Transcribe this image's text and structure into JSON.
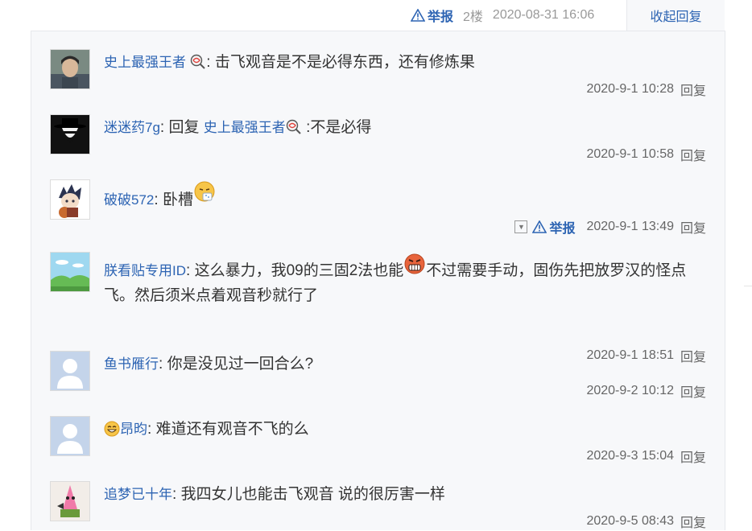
{
  "floor_tail": {
    "report": "举报",
    "floor": "2楼",
    "time": "2020-08-31 16:06",
    "collapse": "收起回复"
  },
  "comments": [
    {
      "user": "史上最强王者",
      "text": "击飞观音是不是必得东西，还有修炼果",
      "time": "2020-9-1 10:28",
      "reply": "回复"
    },
    {
      "user": "迷迷药7g",
      "reply_prefix": "回复",
      "reply_to": "史上最强王者",
      "text": ":不是必得",
      "time": "2020-9-1 10:58",
      "reply": "回复"
    },
    {
      "user": "破破572",
      "text": "卧槽",
      "time": "2020-9-1 13:49",
      "reply": "回复",
      "report": "举报"
    },
    {
      "user": "朕看贴专用ID",
      "text_a": "这么暴力，我09的三固2法也能",
      "text_b": "不过需要手动，固伤先把放罗汉的怪点飞。然后须米点着观音秒就行了",
      "time": "2020-9-1 18:51",
      "reply": "回复"
    },
    {
      "user": "鱼书雁行",
      "text": "你是没见过一回合么?",
      "time": "2020-9-2 10:12",
      "reply": "回复"
    },
    {
      "user": "昂昀",
      "text": "难道还有观音不飞的么",
      "time": "2020-9-3 15:04",
      "reply": "回复"
    },
    {
      "user": "追梦已十年",
      "text": "我四女儿也能击飞观音 说的很厉害一样",
      "time": "2020-9-5 08:43",
      "reply": "回复"
    }
  ]
}
